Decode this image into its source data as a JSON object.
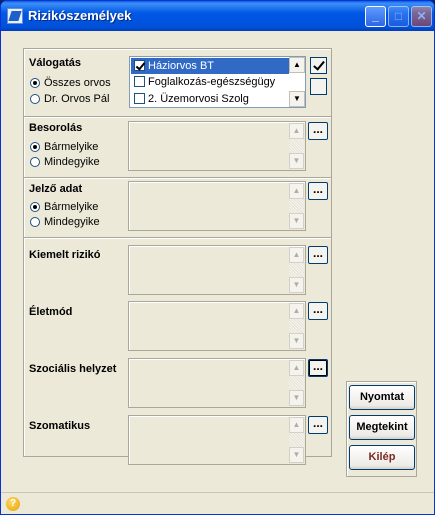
{
  "window": {
    "title": "Rizikószemélyek"
  },
  "valogatas": {
    "label": "Válogatás",
    "options": [
      "Összes orvos",
      "Dr. Orvos Pál"
    ],
    "selected": 0,
    "list": [
      {
        "label": "Háziorvos BT",
        "checked": true,
        "selected": true
      },
      {
        "label": "Foglalkozás-egészségügy",
        "checked": false,
        "selected": false
      },
      {
        "label": "2. Üzemorvosi Szolg",
        "checked": false,
        "selected": false
      }
    ]
  },
  "besorolas": {
    "label": "Besorolás",
    "options": [
      "Bármelyike",
      "Mindegyike"
    ],
    "selected": 0
  },
  "jelzo": {
    "label": "Jelző adat",
    "options": [
      "Bármelyike",
      "Mindegyike"
    ],
    "selected": 0
  },
  "fields": [
    {
      "label": "Kiemelt rizikó"
    },
    {
      "label": "Életmód"
    },
    {
      "label": "Szociális helyzet"
    },
    {
      "label": "Szomatikus"
    }
  ],
  "buttons": {
    "dots": "...",
    "print": "Nyomtat",
    "preview": "Megtekint",
    "exit": "Kilép"
  },
  "icons": {
    "help": "?",
    "scroll_up": "▲",
    "scroll_down": "▼",
    "minimize": "_",
    "maximize": "□",
    "close": "✕"
  }
}
